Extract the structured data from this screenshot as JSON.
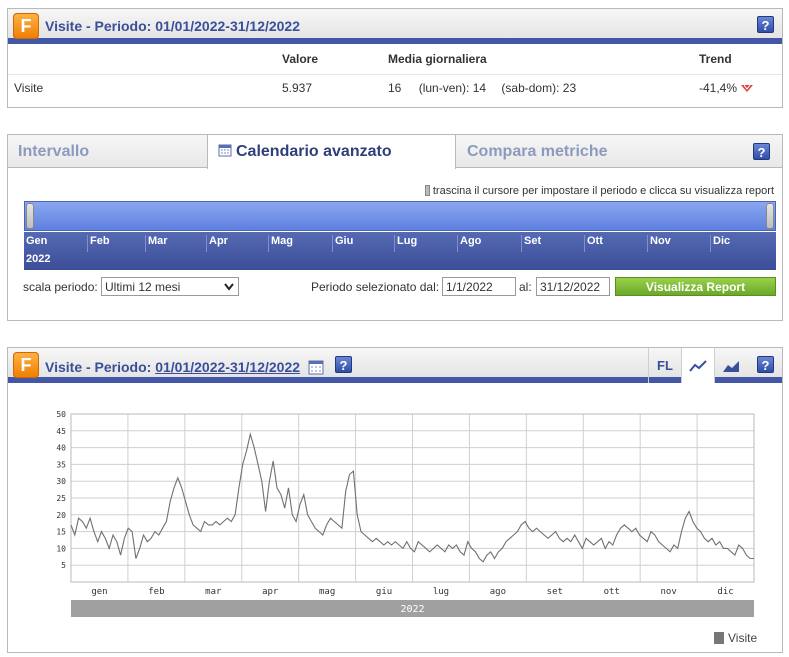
{
  "summary": {
    "title": "Visite - Periodo: 01/01/2022-31/12/2022",
    "logo": "F",
    "help": "?",
    "columns": {
      "valore": "Valore",
      "media": "Media giornaliera",
      "trend": "Trend"
    },
    "row": {
      "name": "Visite",
      "valore": "5.937",
      "media": "16",
      "lunven": "(lun-ven): 14",
      "sabdom": "(sab-dom): 23",
      "trend": "-41,4%"
    },
    "trend_color": "#d9413a"
  },
  "calendar": {
    "tabs": [
      "Intervallo",
      "Calendario avanzato",
      "Compara metriche"
    ],
    "active_tab": "Calendario avanzato",
    "hint": "trascina il cursore per impostare il periodo e clicca su visualizza report",
    "months": [
      "Gen",
      "Feb",
      "Mar",
      "Apr",
      "Mag",
      "Giu",
      "Lug",
      "Ago",
      "Set",
      "Ott",
      "Nov",
      "Dic"
    ],
    "year": "2022",
    "scale_label": "scala periodo:",
    "scale_value": "Ultimi 12 mesi",
    "period_label": "Periodo selezionato dal:",
    "from": "1/1/2022",
    "to_label": "al:",
    "to": "31/12/2022",
    "button": "Visualizza Report"
  },
  "chart_panel": {
    "title_prefix": "Visite - Periodo: ",
    "title_period": "01/01/2022-31/12/2022",
    "fl": "FL",
    "legend": "Visite",
    "year_label": "2022"
  },
  "chart_data": {
    "type": "line",
    "ylim": [
      0,
      50
    ],
    "yticks": [
      5,
      10,
      15,
      20,
      25,
      30,
      35,
      40,
      45,
      50
    ],
    "xticks": [
      "gen",
      "feb",
      "mar",
      "apr",
      "mag",
      "giu",
      "lug",
      "ago",
      "set",
      "ott",
      "nov",
      "dic"
    ],
    "series": [
      {
        "name": "Visite",
        "color": "#707070",
        "values": [
          17,
          14,
          19,
          18,
          16,
          19,
          15,
          12,
          15,
          13,
          10,
          14,
          12,
          8,
          13,
          16,
          15,
          7,
          10,
          14,
          12,
          13,
          15,
          14,
          16,
          18,
          24,
          28,
          31,
          28,
          24,
          20,
          17,
          16,
          15,
          18,
          17,
          17,
          18,
          17,
          18,
          19,
          18,
          20,
          28,
          35,
          39,
          44,
          40,
          35,
          30,
          21,
          30,
          36,
          28,
          26,
          22,
          28,
          20,
          18,
          23,
          26,
          20,
          18,
          16,
          15,
          14,
          17,
          19,
          18,
          17,
          16,
          27,
          32,
          33,
          20,
          15,
          14,
          13,
          12,
          13,
          12,
          11,
          12,
          11,
          12,
          11,
          10,
          12,
          10,
          9,
          12,
          11,
          10,
          9,
          10,
          11,
          10,
          9,
          11,
          10,
          11,
          9,
          8,
          12,
          10,
          9,
          7,
          6,
          8,
          9,
          7,
          9,
          10,
          12,
          13,
          14,
          15,
          17,
          18,
          16,
          15,
          16,
          15,
          14,
          13,
          14,
          15,
          13,
          12,
          13,
          12,
          14,
          12,
          10,
          13,
          12,
          11,
          12,
          13,
          10,
          12,
          11,
          14,
          16,
          17,
          16,
          15,
          16,
          14,
          13,
          12,
          15,
          14,
          12,
          11,
          10,
          9,
          11,
          10,
          15,
          19,
          21,
          18,
          16,
          15,
          13,
          12,
          13,
          11,
          12,
          10,
          10,
          9,
          8,
          11,
          10,
          8,
          7,
          7
        ]
      }
    ]
  }
}
